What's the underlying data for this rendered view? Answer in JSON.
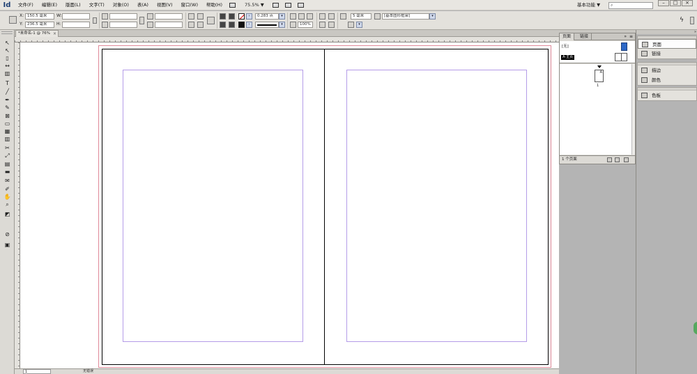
{
  "menubar": {
    "logo": "Id",
    "items": [
      "文件(F)",
      "编辑(E)",
      "版面(L)",
      "文字(T)",
      "对象(O)",
      "表(A)",
      "视图(V)",
      "窗口(W)",
      "帮助(H)"
    ],
    "zoom": "75.5%",
    "zoom_arrow": "▼",
    "workspace": "基本功能",
    "workspace_arrow": "▼",
    "search_placeholder": "",
    "search_icon": "⌕",
    "window_buttons": [
      "–",
      "□",
      "×"
    ]
  },
  "controlbar": {
    "x_label": "X:",
    "x_value": "150.5 毫米",
    "y_label": "Y:",
    "y_value": "236.5 毫米",
    "w_label": "W:",
    "w_value": "",
    "h_label": "H:",
    "h_value": "",
    "stroke_weight": "0.283 点",
    "zoom_percent": "100%",
    "gutter_value": "5 毫米",
    "object_style": "[基本图形框架]"
  },
  "tabs": {
    "doc_tab": "*未命名-1 @ 76%",
    "close": "×"
  },
  "tools": {
    "icons": [
      "selection-tool-icon",
      "direct-selection-tool-icon",
      "page-tool-icon",
      "gap-tool-icon",
      "content-collector-icon",
      "type-tool-icon",
      "line-tool-icon",
      "pen-tool-icon",
      "pencil-tool-icon",
      "rectangle-frame-tool-icon",
      "rectangle-tool-icon",
      "table-tool-icon",
      "columns-tool-icon",
      "scissors-tool-icon",
      "free-transform-tool-icon",
      "gradient-swatch-tool-icon",
      "gradient-feather-tool-icon",
      "note-tool-icon",
      "eyedropper-tool-icon",
      "hand-tool-icon",
      "zoom-tool-icon",
      "fill-stroke-icon",
      "apply-none-icon",
      "screen-mode-icon"
    ],
    "glyphs": [
      "↖",
      "↖",
      "▯",
      "↔",
      "▥",
      "T",
      "╱",
      "✒",
      "✎",
      "⊠",
      "▭",
      "▦",
      "▥",
      "✂",
      "⤢",
      "▤",
      "▬",
      "✉",
      "✐",
      "✋",
      "⌕",
      "◩",
      "⊘",
      "▣"
    ],
    "grip": ""
  },
  "statusbar": {
    "page": "1",
    "message": "无错误"
  },
  "pages_panel": {
    "tabs": [
      "页面",
      "链接"
    ],
    "collapse": "»",
    "menu": "≡",
    "none_label": "[无]",
    "master_label": "A-主页",
    "page_letter": "A",
    "page_number": "1",
    "status": "1 个页面",
    "footer_buttons": [
      "page-size-icon",
      "new-page-icon",
      "delete-page-icon"
    ]
  },
  "right_dock": {
    "group1": [
      {
        "label": "页面",
        "icon": "pages-panel-icon",
        "active": true
      },
      {
        "label": "链接",
        "icon": "links-panel-icon",
        "active": false
      }
    ],
    "group2": [
      {
        "label": "描边",
        "icon": "stroke-panel-icon",
        "active": false
      },
      {
        "label": "颜色",
        "icon": "color-panel-icon",
        "active": false
      }
    ],
    "group3": [
      {
        "label": "色板",
        "icon": "swatches-panel-icon",
        "active": false
      }
    ],
    "topbar_button": "»"
  },
  "colors": {
    "bleed": "#e08a9a",
    "margin": "#b49ce8",
    "master_thumb": "#2c67c6"
  }
}
